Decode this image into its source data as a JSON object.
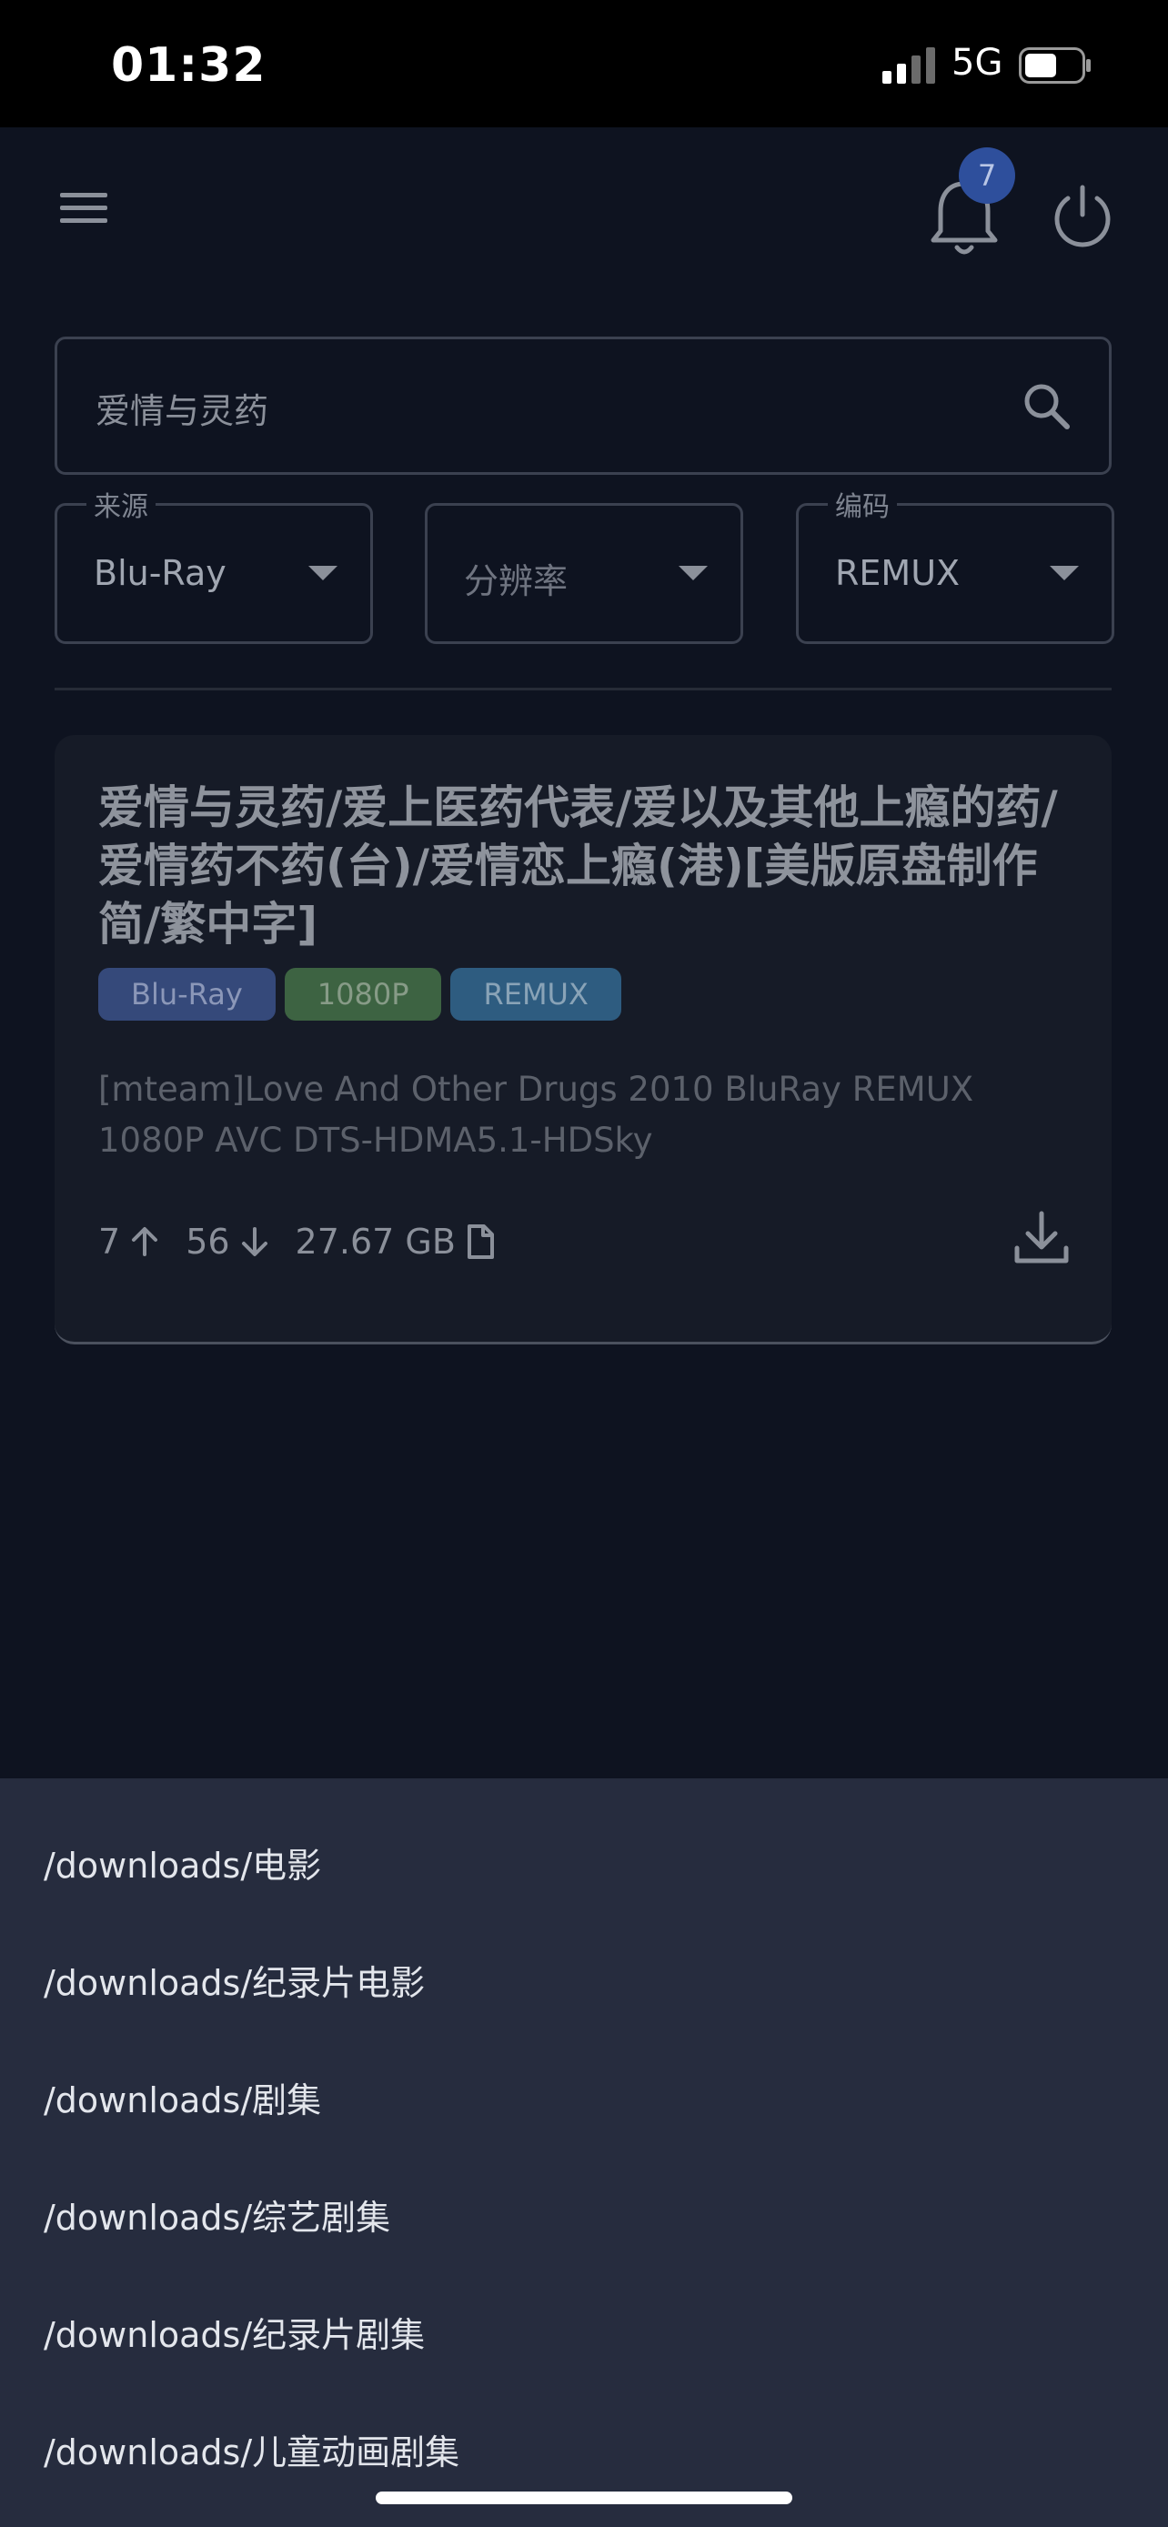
{
  "status_bar": {
    "time": "01:32",
    "network": "5G"
  },
  "app_bar": {
    "notification_count": "7"
  },
  "search": {
    "value": "爱情与灵药"
  },
  "filters": [
    {
      "legend": "来源",
      "value": "Blu-Ray"
    },
    {
      "legend": "",
      "value": "分辨率"
    },
    {
      "legend": "编码",
      "value": "REMUX"
    }
  ],
  "result": {
    "title": "爱情与灵药/爱上医药代表/爱以及其他上瘾的药/爱情药不药(台)/爱情恋上瘾(港)[美版原盘制作简/繁中字]",
    "tags": [
      "Blu-Ray",
      "1080P",
      "REMUX"
    ],
    "subtitle": "[mteam]Love And Other Drugs 2010 BluRay REMUX 1080P AVC DTS-HDMA5.1-HDSky",
    "seeders": "7",
    "leechers": "56",
    "size": "27.67 GB"
  },
  "download_paths": [
    "/downloads/电影",
    "/downloads/纪录片电影",
    "/downloads/剧集",
    "/downloads/综艺剧集",
    "/downloads/纪录片剧集",
    "/downloads/儿童动画剧集"
  ]
}
